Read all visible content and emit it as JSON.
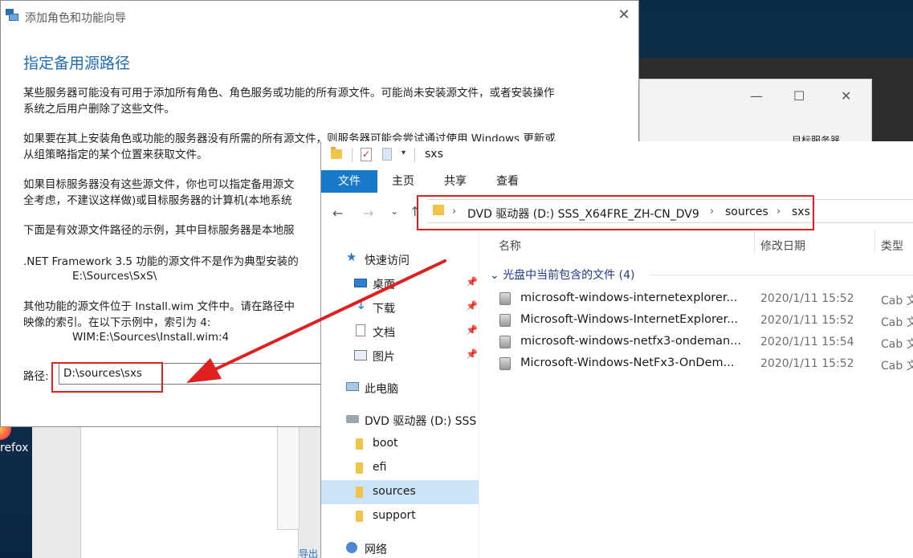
{
  "desktop": {
    "firefox_label": "refox"
  },
  "bg_window": {
    "target_text": "目标服务器",
    "lower_text": "导出"
  },
  "wizard": {
    "title": "添加角色和功能向导",
    "heading": "指定备用源路径",
    "para1_line1": "某些服务器可能没有可用于添加所有角色、角色服务或功能的所有源文件。可能尚未安装源文件，或者安装操作",
    "para1_line2": "系统之后用户删除了这些文件。",
    "para2_line1": "如果要在其上安装角色或功能的服务器没有所需的所有源文件，则服务器可能会尝试通过使用 Windows 更新或",
    "para2_line2": "从组策略指定的某个位置来获取文件。",
    "para3_line1": "如果目标服务器没有这些源文件，你也可以指定备用源文",
    "para3_line2": "全考虑，不建议这样做)或目标服务器的计算机(本地系统",
    "para4_line1": "下面是有效源文件路径的示例，其中目标服务器是本地服",
    "para5_line1": ".NET Framework 3.5 功能的源文件不是作为典型安装的",
    "para5_example": "E:\\Sources\\SxS\\",
    "para6_line1": "其他功能的源文件位于 Install.wim 文件中。请在路径中",
    "para6_line2": "映像的索引。在以下示例中，索引为 4:",
    "para6_example": "WIM:E:\\Sources\\Install.wim:4",
    "path_label": "路径:",
    "path_value": "D:\\sources\\sxs"
  },
  "explorer": {
    "title": "sxs",
    "ribbon_tabs": [
      {
        "label": "文件",
        "active": true
      },
      {
        "label": "主页",
        "active": false
      },
      {
        "label": "共享",
        "active": false
      },
      {
        "label": "查看",
        "active": false
      }
    ],
    "breadcrumb": [
      "DVD 驱动器 (D:) SSS_X64FRE_ZH-CN_DV9",
      "sources",
      "sxs"
    ],
    "columns": {
      "name": "名称",
      "date": "修改日期",
      "type": "类型"
    },
    "nav_items": [
      {
        "label": "快速访问",
        "icon": "star-icon"
      },
      {
        "label": "桌面",
        "icon": "desktop-icon",
        "pinned": true
      },
      {
        "label": "下载",
        "icon": "download-icon",
        "pinned": true
      },
      {
        "label": "文档",
        "icon": "document-icon",
        "pinned": true
      },
      {
        "label": "图片",
        "icon": "picture-icon",
        "pinned": true
      },
      {
        "label": "此电脑",
        "icon": "computer-icon"
      },
      {
        "label": "DVD 驱动器 (D:) SSS",
        "icon": "dvd-drive-icon"
      },
      {
        "label": "boot",
        "icon": "folder-icon"
      },
      {
        "label": "efi",
        "icon": "folder-icon"
      },
      {
        "label": "sources",
        "icon": "folder-icon",
        "selected": true
      },
      {
        "label": "support",
        "icon": "folder-icon"
      },
      {
        "label": "网络",
        "icon": "network-icon"
      }
    ],
    "group_header": "光盘中当前包含的文件 (4)",
    "files": [
      {
        "name": "microsoft-windows-internetexplorer...",
        "date": "2020/1/11 15:52",
        "type": "Cab 文"
      },
      {
        "name": "Microsoft-Windows-InternetExplorer...",
        "date": "2020/1/11 15:52",
        "type": "Cab 文"
      },
      {
        "name": "microsoft-windows-netfx3-ondeman...",
        "date": "2020/1/11 15:54",
        "type": "Cab 文"
      },
      {
        "name": "Microsoft-Windows-NetFx3-OnDem...",
        "date": "2020/1/11 15:52",
        "type": "Cab 文"
      }
    ]
  },
  "colors": {
    "accent": "#1979ca",
    "highlight": "#e02020",
    "heading": "#1f6bb2"
  }
}
